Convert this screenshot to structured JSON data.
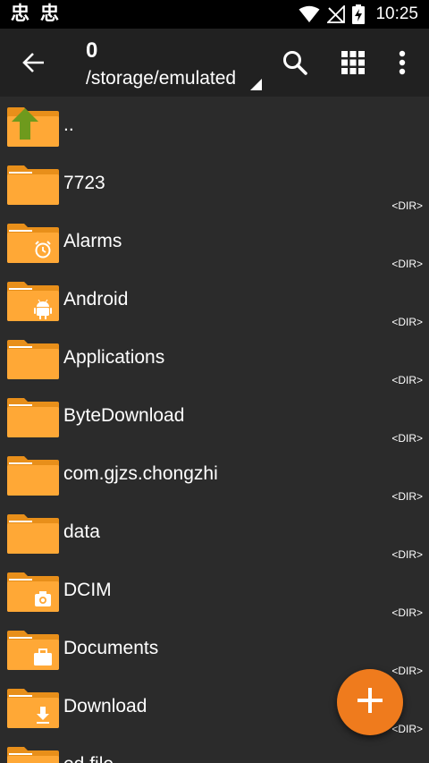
{
  "status_bar": {
    "app_icons": [
      "忠",
      "忠"
    ],
    "time": "10:25",
    "icons": [
      "wifi-icon",
      "no-signal-icon",
      "battery-charging-icon"
    ]
  },
  "toolbar": {
    "title": "0",
    "path": "/storage/emulated",
    "icons": [
      "back-arrow-icon",
      "search-icon",
      "grid-view-icon",
      "more-vert-icon"
    ]
  },
  "files": [
    {
      "name": "..",
      "type": "",
      "icon": "parent-up"
    },
    {
      "name": "7723",
      "type": "<DIR>",
      "icon": "folder"
    },
    {
      "name": "Alarms",
      "type": "<DIR>",
      "icon": "folder-alarm"
    },
    {
      "name": "Android",
      "type": "<DIR>",
      "icon": "folder-android"
    },
    {
      "name": "Applications",
      "type": "<DIR>",
      "icon": "folder"
    },
    {
      "name": "ByteDownload",
      "type": "<DIR>",
      "icon": "folder"
    },
    {
      "name": "com.gjzs.chongzhi",
      "type": "<DIR>",
      "icon": "folder"
    },
    {
      "name": "data",
      "type": "<DIR>",
      "icon": "folder"
    },
    {
      "name": "DCIM",
      "type": "<DIR>",
      "icon": "folder-camera"
    },
    {
      "name": "Documents",
      "type": "<DIR>",
      "icon": "folder-briefcase"
    },
    {
      "name": "Download",
      "type": "<DIR>",
      "icon": "folder-download"
    },
    {
      "name": "ed.file",
      "type": "",
      "icon": "folder"
    }
  ],
  "fab": {
    "icon": "plus-icon"
  },
  "colors": {
    "background": "#2b2b2b",
    "toolbar": "#212121",
    "status_bar": "#000000",
    "folder_back": "#e88f1a",
    "folder_front": "#ffa836",
    "fab": "#ef7b1d",
    "parent_arrow": "#6e9a1d"
  }
}
